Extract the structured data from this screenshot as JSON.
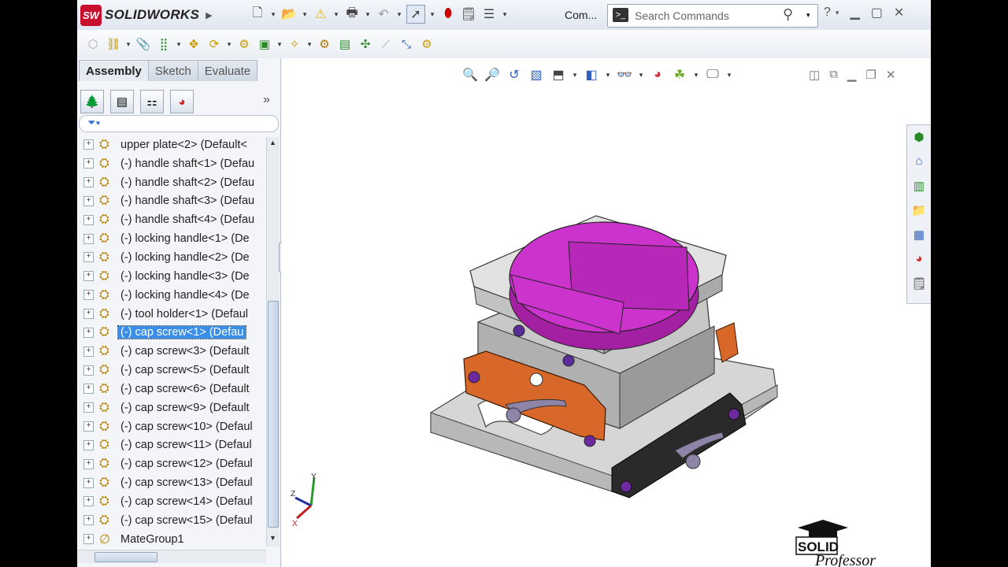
{
  "app": {
    "name": "SOLIDWORKS",
    "badge": "SW"
  },
  "titlebar": {
    "commands_label": "Com...",
    "search": {
      "placeholder": "Search Commands"
    }
  },
  "panel": {
    "tabs": [
      {
        "label": "Assembly",
        "active": true
      },
      {
        "label": "Sketch",
        "active": false
      },
      {
        "label": "Evaluate",
        "active": false
      }
    ]
  },
  "tree": {
    "selected_index": 10,
    "items": [
      {
        "label": "upper plate<2> (Default<"
      },
      {
        "label": "(-) handle shaft<1> (Defau"
      },
      {
        "label": "(-) handle shaft<2> (Defau"
      },
      {
        "label": "(-) handle shaft<3> (Defau"
      },
      {
        "label": "(-) handle shaft<4> (Defau"
      },
      {
        "label": "(-) locking handle<1> (De"
      },
      {
        "label": "(-) locking handle<2> (De"
      },
      {
        "label": "(-) locking handle<3> (De"
      },
      {
        "label": "(-) locking handle<4> (De"
      },
      {
        "label": "(-) tool holder<1> (Defaul"
      },
      {
        "label": "(-) cap screw<1> (Defau"
      },
      {
        "label": "(-) cap screw<3> (Default"
      },
      {
        "label": "(-) cap screw<5> (Default"
      },
      {
        "label": "(-) cap screw<6> (Default"
      },
      {
        "label": "(-) cap screw<9> (Default"
      },
      {
        "label": "(-) cap screw<10> (Defaul"
      },
      {
        "label": "(-) cap screw<11> (Defaul"
      },
      {
        "label": "(-) cap screw<12> (Defaul"
      },
      {
        "label": "(-) cap screw<13> (Defaul"
      },
      {
        "label": "(-) cap screw<14> (Defaul"
      },
      {
        "label": "(-) cap screw<15> (Defaul"
      },
      {
        "label": "MateGroup1"
      }
    ]
  },
  "triad": {
    "z": "Z",
    "y": "Y",
    "x": "X"
  },
  "watermark": {
    "line1": "SOLID",
    "line2": "Professor"
  },
  "colors": {
    "selection": "#3a8ee6",
    "part_top": "#cc33cc",
    "part_accent": "#d8672a",
    "base": "#d9d9d9"
  }
}
